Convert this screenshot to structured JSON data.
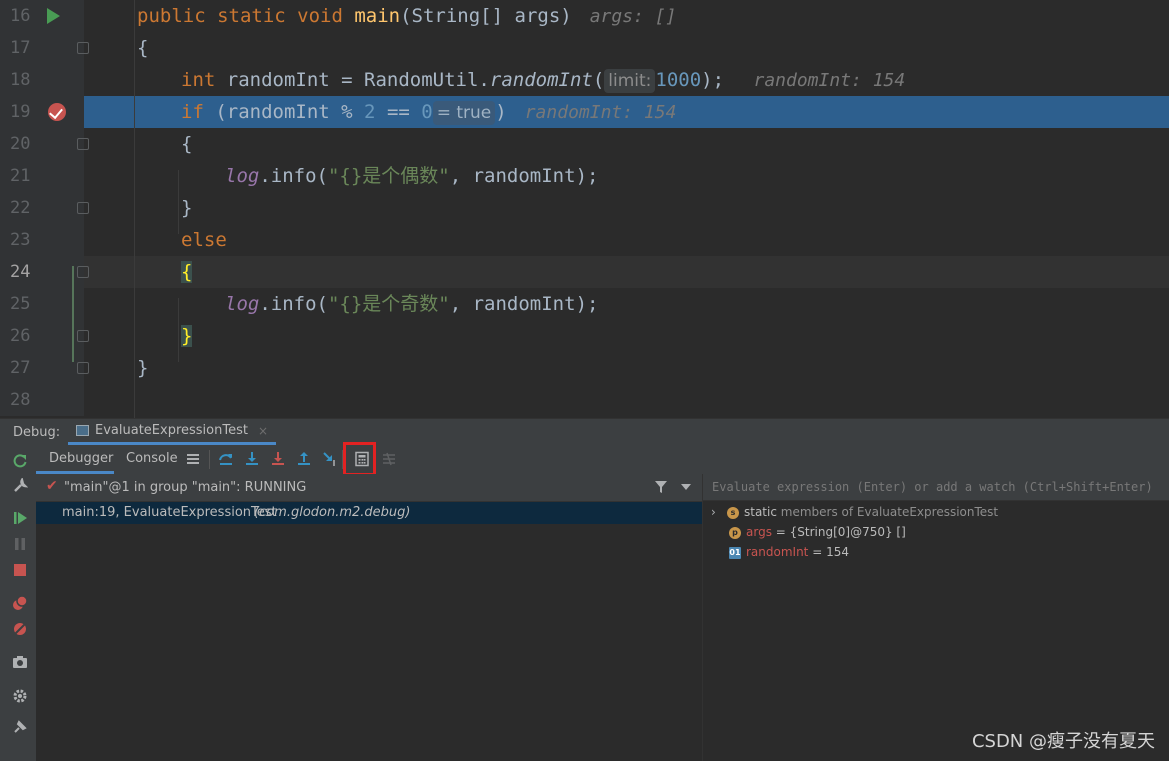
{
  "editor": {
    "lines": [
      {
        "n": "16",
        "parts": [
          [
            "kw",
            "public static void "
          ],
          [
            "fn",
            "main"
          ],
          [
            "",
            "(String[] args)"
          ]
        ],
        "hint": "args: []"
      },
      {
        "n": "17",
        "parts": [
          [
            "",
            "{"
          ]
        ]
      },
      {
        "n": "18",
        "parts": [
          [
            "kw",
            "int "
          ],
          [
            "",
            "randomInt = RandomUtil."
          ],
          [
            "it",
            "randomInt"
          ],
          [
            "",
            "("
          ]
        ],
        "param_hint": "limit:",
        "after": [
          [
            "num",
            "1000"
          ],
          [
            "",
            "); "
          ]
        ],
        "hint": "randomInt: 154"
      },
      {
        "n": "19",
        "parts": [
          [
            "kw",
            "if "
          ],
          [
            "",
            "(randomInt % "
          ],
          [
            "num",
            "2 "
          ],
          [
            "",
            "== "
          ],
          [
            "num",
            "0"
          ]
        ],
        "inline_value": "= true",
        "after": [
          [
            "",
            ")"
          ]
        ],
        "hint": "randomInt: 154"
      },
      {
        "n": "20",
        "parts": [
          [
            "",
            "{"
          ]
        ]
      },
      {
        "n": "21",
        "parts": [
          [
            "logv",
            "log"
          ],
          [
            "",
            ".info("
          ],
          [
            "str",
            "\"{}是个偶数\""
          ],
          [
            "",
            ", randomInt);"
          ]
        ]
      },
      {
        "n": "22",
        "parts": [
          [
            "",
            "}"
          ]
        ]
      },
      {
        "n": "23",
        "parts": [
          [
            "kw",
            "else"
          ]
        ]
      },
      {
        "n": "24",
        "parts": [
          [
            "brace",
            "{"
          ]
        ]
      },
      {
        "n": "25",
        "parts": [
          [
            "logv",
            "log"
          ],
          [
            "",
            ".info("
          ],
          [
            "str",
            "\"{}是个奇数\""
          ],
          [
            "",
            ", randomInt);"
          ]
        ]
      },
      {
        "n": "26",
        "parts": [
          [
            "brace",
            "}"
          ]
        ]
      },
      {
        "n": "27",
        "parts": [
          [
            "",
            "}"
          ]
        ]
      },
      {
        "n": "28",
        "parts": []
      }
    ]
  },
  "debug": {
    "title": "Debug:",
    "run_config": "EvaluateExpressionTest",
    "tabs": {
      "debugger": "Debugger",
      "console": "Console"
    },
    "thread": "\"main\"@1 in group \"main\": RUNNING",
    "frame": {
      "location": "main:19, EvaluateExpressionTest",
      "package": "(com.glodon.m2.debug)"
    },
    "eval_placeholder": "Evaluate expression (Enter) or add a watch (Ctrl+Shift+Enter)",
    "vars": {
      "static": {
        "label": "static",
        "rest": "members of EvaluateExpressionTest"
      },
      "args": {
        "name": "args",
        "value": " = {String[0]@750} []"
      },
      "randomInt": {
        "name": "randomInt",
        "value": " = 154"
      }
    }
  },
  "watermark": "CSDN @瘦子没有夏天",
  "colors": {
    "exec_line": "#2d5f8e",
    "highlight_box": "#e32222",
    "breakpoint": "#c75450"
  }
}
